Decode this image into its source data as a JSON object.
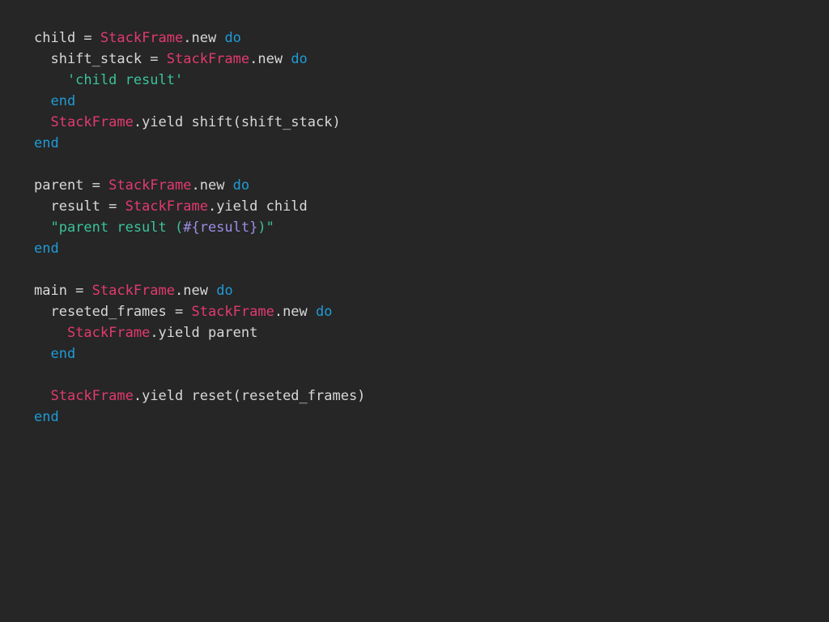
{
  "colors": {
    "background": "#262626",
    "plain": "#d8d8d8",
    "const": "#e23a6f",
    "kw": "#1f9bd6",
    "str": "#3ac29a",
    "interp": "#9a8ee6"
  },
  "code": {
    "lines": [
      [
        [
          "plain",
          "child = "
        ],
        [
          "const",
          "StackFrame"
        ],
        [
          "plain",
          ".new "
        ],
        [
          "kw",
          "do"
        ]
      ],
      [
        [
          "plain",
          "  shift_stack = "
        ],
        [
          "const",
          "StackFrame"
        ],
        [
          "plain",
          ".new "
        ],
        [
          "kw",
          "do"
        ]
      ],
      [
        [
          "str",
          "    'child result'"
        ]
      ],
      [
        [
          "kw",
          "  end"
        ]
      ],
      [
        [
          "plain",
          "  "
        ],
        [
          "const",
          "StackFrame"
        ],
        [
          "plain",
          ".yield shift(shift_stack)"
        ]
      ],
      [
        [
          "kw",
          "end"
        ]
      ],
      [],
      [
        [
          "plain",
          "parent = "
        ],
        [
          "const",
          "StackFrame"
        ],
        [
          "plain",
          ".new "
        ],
        [
          "kw",
          "do"
        ]
      ],
      [
        [
          "plain",
          "  result = "
        ],
        [
          "const",
          "StackFrame"
        ],
        [
          "plain",
          ".yield child"
        ]
      ],
      [
        [
          "str",
          "  \"parent result ("
        ],
        [
          "interp",
          "#{result}"
        ],
        [
          "str",
          ")\""
        ]
      ],
      [
        [
          "kw",
          "end"
        ]
      ],
      [],
      [
        [
          "plain",
          "main = "
        ],
        [
          "const",
          "StackFrame"
        ],
        [
          "plain",
          ".new "
        ],
        [
          "kw",
          "do"
        ]
      ],
      [
        [
          "plain",
          "  reseted_frames = "
        ],
        [
          "const",
          "StackFrame"
        ],
        [
          "plain",
          ".new "
        ],
        [
          "kw",
          "do"
        ]
      ],
      [
        [
          "plain",
          "    "
        ],
        [
          "const",
          "StackFrame"
        ],
        [
          "plain",
          ".yield parent"
        ]
      ],
      [
        [
          "kw",
          "  end"
        ]
      ],
      [],
      [
        [
          "plain",
          "  "
        ],
        [
          "const",
          "StackFrame"
        ],
        [
          "plain",
          ".yield reset(reseted_frames)"
        ]
      ],
      [
        [
          "kw",
          "end"
        ]
      ]
    ]
  }
}
